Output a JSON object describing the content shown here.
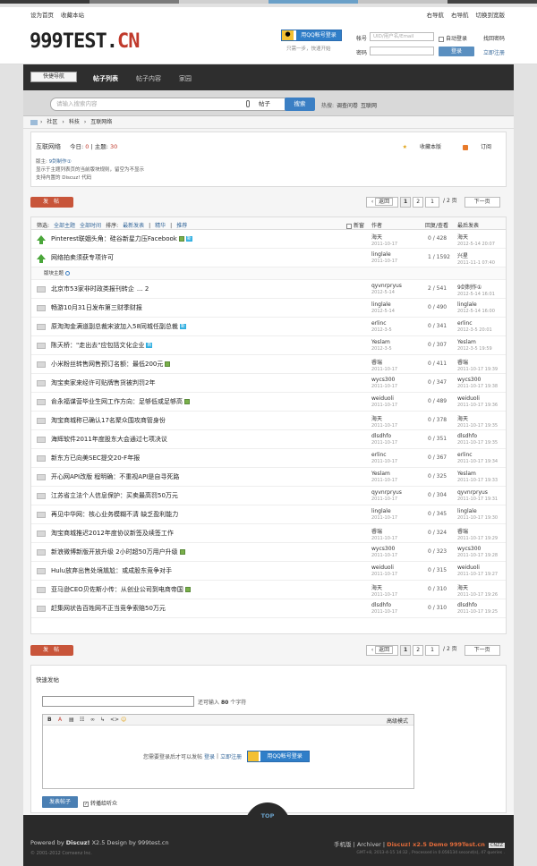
{
  "toplinks": {
    "left": [
      "设为首页",
      "收藏本站"
    ],
    "right": [
      "右导航",
      "右导航",
      "切换到宽版"
    ]
  },
  "header": {
    "logo_main": "999TEST.",
    "logo_accent": "CN",
    "qq_login": "用QQ帐号登录",
    "qq_hint": "只需一步，快速开始",
    "account_label": "帐号",
    "account_placeholder": "UID/用户名/Email",
    "auto_login": "自动登录",
    "find_pwd": "找回密码",
    "pwd_label": "密码",
    "login": "登录",
    "register": "立即注册"
  },
  "nav": {
    "items": [
      "门户",
      "社区",
      "帖子列表",
      "帖子内容",
      "家园"
    ],
    "active": 2,
    "quick": "快捷导航"
  },
  "search": {
    "placeholder": "请输入搜索内容",
    "category": "帖子",
    "button": "搜索",
    "hot_label": "热搜:",
    "hot": [
      "调查问卷",
      "互联网"
    ]
  },
  "breadcrumb": [
    "社区",
    "科技",
    "互联网络"
  ],
  "forum": {
    "name": "互联网络",
    "today_label": "今日:",
    "today": "0",
    "topics_label": "主题:",
    "topics": "30",
    "fav": "收藏本版",
    "rss": "订阅",
    "mod_label": "版主:",
    "mod": "9剑制作①",
    "desc1": "显示于主题列表页的当前版块规则，留空为不显示",
    "desc2": "支持内置的 Discuz! 代码"
  },
  "post_btn": "发 帖",
  "pager": {
    "back": "返回",
    "p1": "1",
    "p2": "2",
    "cur": "1",
    "total": "/ 2 页",
    "next": "下一页"
  },
  "filter": {
    "label": "筛选:",
    "all_topics": "全部主题",
    "all_time": "全部时间",
    "sort_label": "排序:",
    "latest": "最新发表",
    "best": "精华",
    "rec": "推荐",
    "new_win": "新窗"
  },
  "cols": {
    "author": "作者",
    "reply_view": "回复/查看",
    "last": "最后发表"
  },
  "sticky": [
    {
      "title": "Pinterest联姻头角：硅谷新星力压Facebook",
      "att": true,
      "tag": "新",
      "author": "海天",
      "date": "2011-10-17",
      "count": "0 / 428",
      "last": "海天",
      "ldate": "2012-5-14 20:07"
    },
    {
      "title": "网络拍卖须获专项许可",
      "att": false,
      "tag": "",
      "author": "linglale",
      "date": "2011-10-17",
      "count": "1 / 1592",
      "last": "兴星",
      "ldate": "2011-11-1 07:40"
    }
  ],
  "sep": "版块主题",
  "threads": [
    {
      "title": "北京市53家非时政类报刊转企",
      "pages": "... 2",
      "att": false,
      "tag": "",
      "author": "qyvnrpryus",
      "date": "2012-5-14",
      "count": "2 / 541",
      "last": "9剑制作①",
      "ldate": "2012-5-14 16:01"
    },
    {
      "title": "畅游10月31日发布第三财季财报",
      "att": false,
      "tag": "",
      "author": "linglale",
      "date": "2012-5-14",
      "count": "0 / 490",
      "last": "linglale",
      "ldate": "2012-5-14 16:00"
    },
    {
      "title": "原淘淘金满道副总裁宋波加入58同城任副总裁",
      "att": false,
      "tag": "新",
      "author": "erlinc",
      "date": "2012-3-5",
      "count": "0 / 341",
      "last": "erlinc",
      "ldate": "2012-3-5 20:01"
    },
    {
      "title": "陈天桥：\"走出去\"应包括文化企业",
      "att": false,
      "tag": "新",
      "author": "Yeslam",
      "date": "2012-3-5",
      "count": "0 / 307",
      "last": "Yeslam",
      "ldate": "2012-3-5 19:59"
    },
    {
      "title": "小米粉丝转售网售预订名额：最低200元",
      "att": true,
      "tag": "",
      "author": "睿瑞",
      "date": "2011-10-17",
      "count": "0 / 411",
      "last": "睿瑞",
      "ldate": "2011-10-17 19:39"
    },
    {
      "title": "淘宝卖家来经许可贴牌售货被判罚2年",
      "att": false,
      "tag": "",
      "author": "wycs300",
      "date": "2011-10-17",
      "count": "0 / 347",
      "last": "wycs300",
      "ldate": "2011-10-17 19:38"
    },
    {
      "title": "俞永福谋营毕业生网工作方向：足够低或足够高",
      "att": true,
      "tag": "",
      "author": "weiduoli",
      "date": "2011-10-17",
      "count": "0 / 489",
      "last": "weiduoli",
      "ldate": "2011-10-17 19:36"
    },
    {
      "title": "淘宝商城称已确认17名聚众围攻商管身份",
      "att": false,
      "tag": "",
      "author": "海天",
      "date": "2011-10-17",
      "count": "0 / 378",
      "last": "海天",
      "ldate": "2011-10-17 19:35"
    },
    {
      "title": "海辉软件2011年度股东大会通过七项决议",
      "att": false,
      "tag": "",
      "author": "dlsdhfo",
      "date": "2011-10-17",
      "count": "0 / 351",
      "last": "dlsdhfo",
      "ldate": "2011-10-17 19:35"
    },
    {
      "title": "新东方已向美SEC提交20-F年报",
      "att": false,
      "tag": "",
      "author": "erlinc",
      "date": "2011-10-17",
      "count": "0 / 367",
      "last": "erlinc",
      "ldate": "2011-10-17 19:34"
    },
    {
      "title": "开心网API改版 程明确：不重视API是自寻死路",
      "att": false,
      "tag": "",
      "author": "Yeslam",
      "date": "2011-10-17",
      "count": "0 / 325",
      "last": "Yeslam",
      "ldate": "2011-10-17 19:33"
    },
    {
      "title": "江苏省立法个人信息保护：买卖最高罚50万元",
      "att": false,
      "tag": "",
      "author": "qyvnrpryus",
      "date": "2011-10-17",
      "count": "0 / 304",
      "last": "qyvnrpryus",
      "ldate": "2011-10-17 19:31"
    },
    {
      "title": "再见中华网：核心业务模糊不清 缺乏盈利能力",
      "att": false,
      "tag": "",
      "author": "linglale",
      "date": "2011-10-17",
      "count": "0 / 345",
      "last": "linglale",
      "ldate": "2011-10-17 19:30"
    },
    {
      "title": "淘宝商城推迟2012年度协议新签及续签工作",
      "att": false,
      "tag": "",
      "author": "睿瑞",
      "date": "2011-10-17",
      "count": "0 / 324",
      "last": "睿瑞",
      "ldate": "2011-10-17 19:29"
    },
    {
      "title": "新浪微博新版开放升级 2小时超50万用户升级",
      "att": true,
      "tag": "",
      "author": "wycs300",
      "date": "2011-10-17",
      "count": "0 / 323",
      "last": "wycs300",
      "ldate": "2011-10-17 19:28"
    },
    {
      "title": "Hulu放弃出售处境尴尬：或成股东竞争对手",
      "att": false,
      "tag": "",
      "author": "weiduoli",
      "date": "2011-10-17",
      "count": "0 / 315",
      "last": "weiduoli",
      "ldate": "2011-10-17 19:27"
    },
    {
      "title": "亚马逊CEO贝佐斯小传：从创业公司到电商帝国",
      "att": true,
      "tag": "",
      "author": "海天",
      "date": "2011-10-17",
      "count": "0 / 310",
      "last": "海天",
      "ldate": "2011-10-17 19:26"
    },
    {
      "title": "赶集网状告百姓网不正当竞争索赔50万元",
      "att": false,
      "tag": "",
      "author": "dlsdhfo",
      "date": "2011-10-17",
      "count": "0 / 310",
      "last": "dlsdhfo",
      "ldate": "2011-10-17 19:25"
    }
  ],
  "quick_post": {
    "title": "快速发帖",
    "limit_pre": "还可输入",
    "limit": "80",
    "limit_post": "个字符",
    "toolbar": [
      "B",
      "A",
      "▤",
      "☷",
      "∞",
      "↳",
      "<>",
      "☺"
    ],
    "advanced": "高级模式",
    "need_login": "您需要登录后才可以发帖",
    "login": "登录",
    "register": "立即注册",
    "qq": "用QQ帐号登录",
    "submit": "发表帖子",
    "sync": "转播给听众"
  },
  "footer": {
    "top": "TOP",
    "powered_pre": "Powered by",
    "powered_brand": "Discuz!",
    "powered_post": "X2.5 Design by 999test.cn",
    "copyright": "© 2001-2012 Comsenz Inc.",
    "right_links": "手机版 | Archiver |",
    "demo": "Discuz! x2.5 Demo 999Test.cn",
    "cnzz": "CNZZ",
    "gmt": "GMT+8, 2013-4-15 14:32 , Processed in 0.056134 second(s), 47 queries ."
  },
  "colors": {
    "accent": "#3b7fc4",
    "post": "#c8553a",
    "logo_accent": "#c0392b"
  }
}
